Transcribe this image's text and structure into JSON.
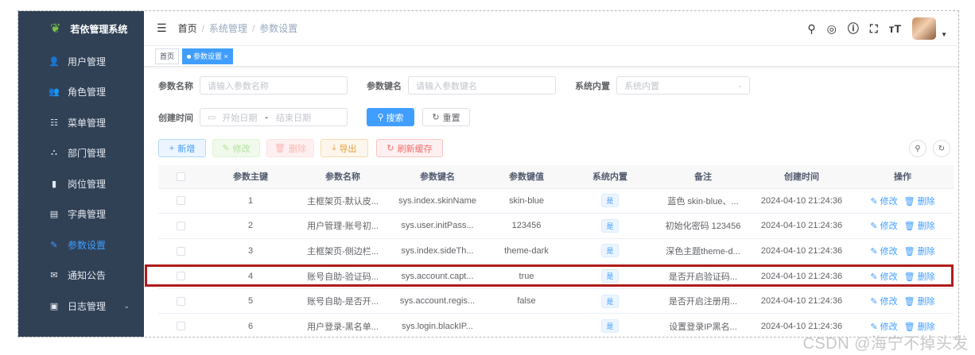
{
  "app": {
    "title": "若依管理系统"
  },
  "sidebar": {
    "items": [
      {
        "label": "用户管理",
        "icon": "user-icon"
      },
      {
        "label": "角色管理",
        "icon": "peoples-icon"
      },
      {
        "label": "菜单管理",
        "icon": "tree-table-icon"
      },
      {
        "label": "部门管理",
        "icon": "tree-icon"
      },
      {
        "label": "岗位管理",
        "icon": "post-icon"
      },
      {
        "label": "字典管理",
        "icon": "dict-icon"
      },
      {
        "label": "参数设置",
        "icon": "edit-icon",
        "active": true
      },
      {
        "label": "通知公告",
        "icon": "message-icon"
      },
      {
        "label": "日志管理",
        "icon": "log-icon",
        "expandable": true
      }
    ]
  },
  "breadcrumb": {
    "home": "首页",
    "level1": "系统管理",
    "level2": "参数设置"
  },
  "navbar_icons": [
    "search-icon",
    "github-icon",
    "question-icon",
    "fullscreen-icon",
    "font-size-icon"
  ],
  "tags": {
    "home": "首页",
    "active": "参数设置"
  },
  "search_form": {
    "config_name_label": "参数名称",
    "config_name_placeholder": "请输入参数名称",
    "config_key_label": "参数键名",
    "config_key_placeholder": "请输入参数键名",
    "config_type_label": "系统内置",
    "config_type_placeholder": "系统内置",
    "create_time_label": "创建时间",
    "start_date_placeholder": "开始日期",
    "range_sep": "-",
    "end_date_placeholder": "结束日期",
    "search_button": "搜索",
    "reset_button": "重置"
  },
  "toolbar": {
    "add": "新增",
    "edit": "修改",
    "delete": "删除",
    "export": "导出",
    "refresh_cache": "刷新缓存"
  },
  "table": {
    "columns": [
      "参数主键",
      "参数名称",
      "参数键名",
      "参数键值",
      "系统内置",
      "备注",
      "创建时间",
      "操作"
    ],
    "rows": [
      {
        "id": "1",
        "name": "主框架页-默认皮...",
        "key": "sys.index.skinName",
        "value": "skin-blue",
        "builtin": "是",
        "remark": "蓝色 skin-blue、...",
        "time": "2024-04-10 21:24:36"
      },
      {
        "id": "2",
        "name": "用户管理-账号初...",
        "key": "sys.user.initPass...",
        "value": "123456",
        "builtin": "是",
        "remark": "初始化密码 123456",
        "time": "2024-04-10 21:24:36"
      },
      {
        "id": "3",
        "name": "主框架页-侧边栏...",
        "key": "sys.index.sideTh...",
        "value": "theme-dark",
        "builtin": "是",
        "remark": "深色主题theme-d...",
        "time": "2024-04-10 21:24:36"
      },
      {
        "id": "4",
        "name": "账号自助-验证码...",
        "key": "sys.account.capt...",
        "value": "true",
        "builtin": "是",
        "remark": "是否开启验证码...",
        "time": "2024-04-10 21:24:36"
      },
      {
        "id": "5",
        "name": "账号自助-是否开...",
        "key": "sys.account.regis...",
        "value": "false",
        "builtin": "是",
        "remark": "是否开启注册用...",
        "time": "2024-04-10 21:24:36"
      },
      {
        "id": "6",
        "name": "用户登录-黑名单...",
        "key": "sys.login.blackIP...",
        "value": "",
        "builtin": "是",
        "remark": "设置登录IP黑名...",
        "time": "2024-04-10 21:24:36"
      }
    ],
    "edit_label": "修改",
    "delete_label": "删除"
  },
  "watermark": "CSDN @海宁不掉头发",
  "colors": {
    "sidebar_bg": "#304156",
    "primary": "#409eff",
    "highlight": "#b11b1b"
  }
}
